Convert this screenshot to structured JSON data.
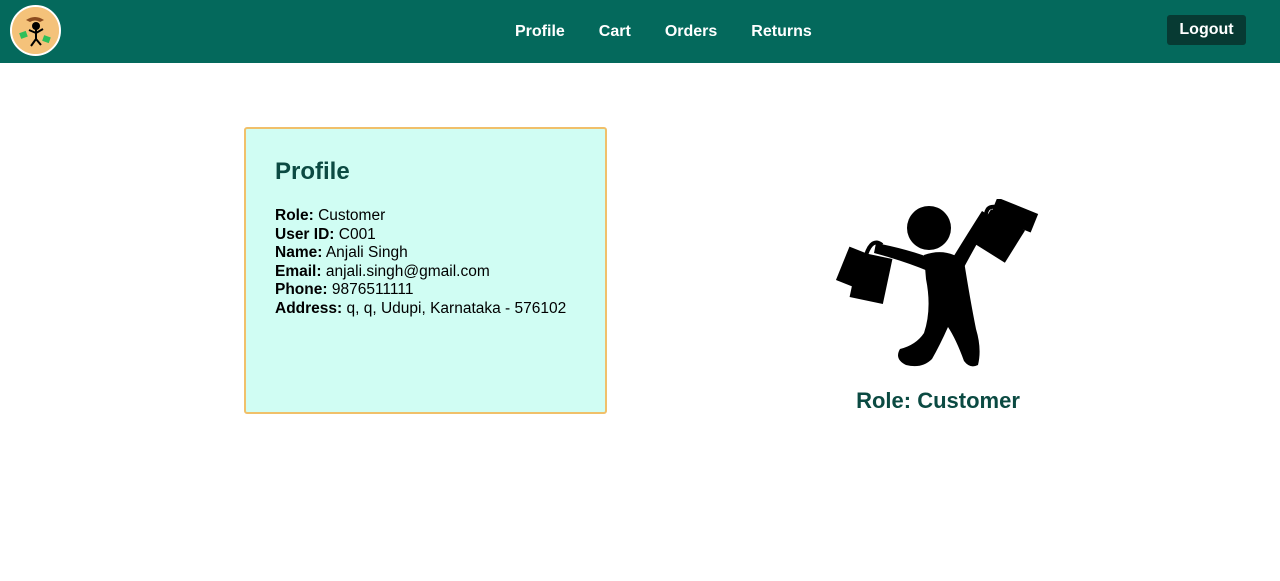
{
  "nav": {
    "links": [
      "Profile",
      "Cart",
      "Orders",
      "Returns"
    ],
    "logout_label": "Logout"
  },
  "profile": {
    "title": "Profile",
    "fields": [
      {
        "label": "Role:",
        "value": "Customer"
      },
      {
        "label": "User ID:",
        "value": "C001"
      },
      {
        "label": "Name:",
        "value": "Anjali Singh"
      },
      {
        "label": "Email:",
        "value": "anjali.singh@gmail.com"
      },
      {
        "label": "Phone:",
        "value": "9876511111"
      },
      {
        "label": "Address:",
        "value": "q, q, Udupi, Karnataka - 576102"
      }
    ]
  },
  "role_caption": "Role: Customer",
  "icons": {
    "logo": "shopper-logo-icon",
    "illustration": "shopper-with-bags-icon"
  },
  "colors": {
    "navbar": "#04695c",
    "logout_button": "#073a33",
    "card_background": "#d0fdf3",
    "card_border": "#f0c06a",
    "heading_text": "#0b4a42"
  }
}
